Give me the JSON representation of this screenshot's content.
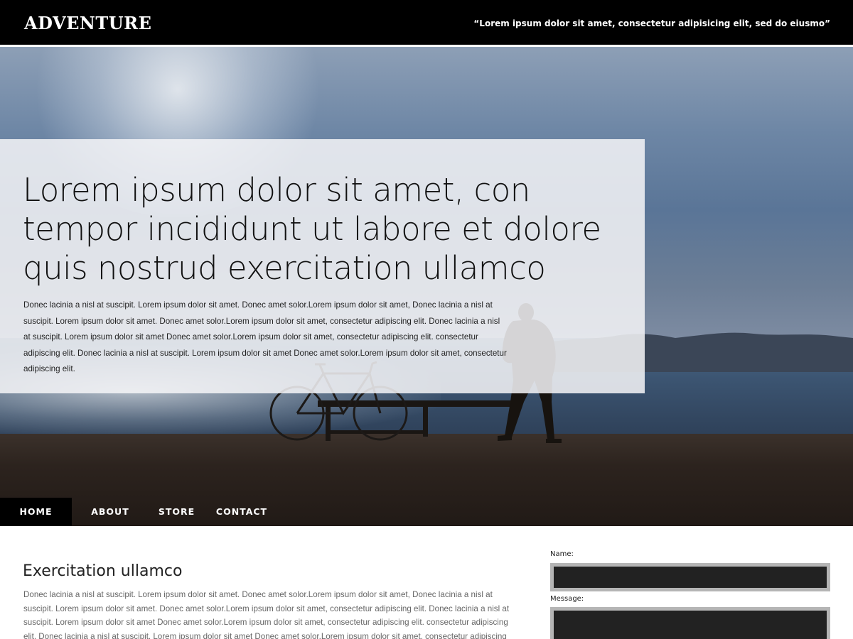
{
  "header": {
    "brand": "ADVENTURE",
    "tagline": "“Lorem ipsum dolor sit amet, consectetur adipisicing elit, sed do eiusmo”"
  },
  "hero": {
    "headline": "Lorem ipsum dolor sit amet, con tempor incididunt ut labore et dolore quis nostrud exercitation ullamco",
    "text": "Donec lacinia a nisl at suscipit. Lorem ipsum dolor sit amet. Donec amet solor.Lorem ipsum dolor sit amet, Donec lacinia a nisl at suscipit. Lorem ipsum dolor sit amet. Donec amet solor.Lorem ipsum dolor sit amet, consectetur adipiscing elit. Donec lacinia a nisl at suscipit. Lorem ipsum dolor sit amet Donec amet solor.Lorem ipsum dolor sit amet, consectetur adipiscing elit. consectetur adipiscing elit. Donec lacinia a nisl at suscipit. Lorem ipsum dolor sit amet Donec amet solor.Lorem ipsum dolor sit amet, consectetur adipiscing elit."
  },
  "nav": {
    "items": [
      {
        "label": "HOME",
        "active": true
      },
      {
        "label": "ABOUT",
        "active": false
      },
      {
        "label": "STORE",
        "active": false
      },
      {
        "label": "CONTACT",
        "active": false
      }
    ]
  },
  "content": {
    "title": "Exercitation ullamco",
    "text": "Donec lacinia a nisl at suscipit. Lorem ipsum dolor sit amet. Donec amet solor.Lorem ipsum dolor sit amet, Donec lacinia a nisl at suscipit. Lorem ipsum dolor sit amet. Donec amet solor.Lorem ipsum dolor sit amet, consectetur adipiscing elit. Donec lacinia a nisl at suscipit. Lorem ipsum dolor sit amet Donec amet solor.Lorem ipsum dolor sit amet, consectetur adipiscing elit. consectetur adipiscing elit. Donec lacinia a nisl at suscipit. Lorem ipsum dolor sit amet Donec amet solor.Lorem ipsum dolor sit amet, consectetur adipiscing elit."
  },
  "form": {
    "name_label": "Name:",
    "name_value": "",
    "message_label": "Message:",
    "message_value": ""
  },
  "colors": {
    "header_bg": "#000000",
    "nav_active_bg": "#000000",
    "field_bg": "#222222",
    "field_border": "#b5b5b5",
    "panel_overlay": "#f4f5f7"
  }
}
